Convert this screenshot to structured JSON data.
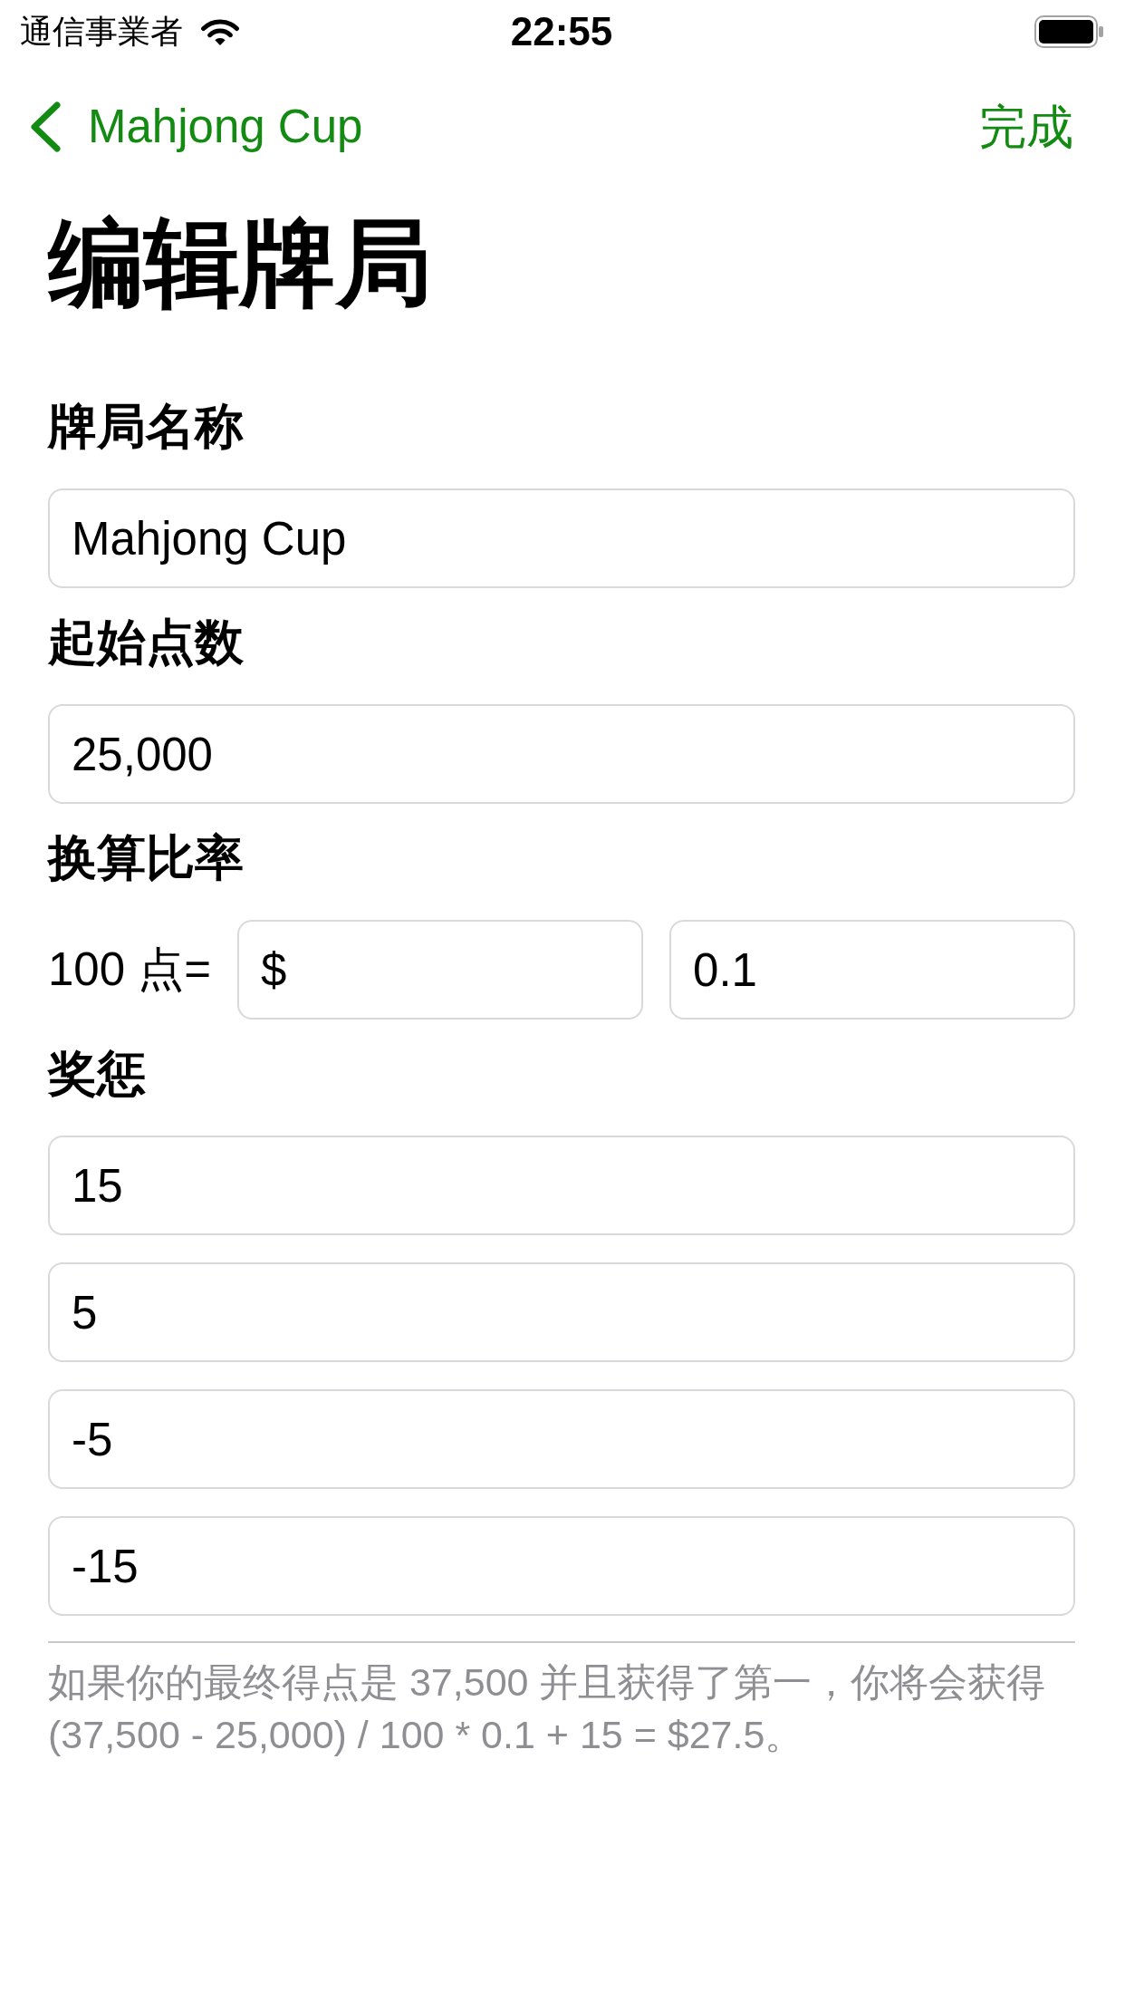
{
  "status_bar": {
    "carrier": "通信事業者",
    "time": "22:55"
  },
  "nav_bar": {
    "back_label": "Mahjong Cup",
    "done": "完成"
  },
  "title": "编辑牌局",
  "sections": [
    {
      "label": "牌局名称",
      "kind": "text",
      "fields": [
        {
          "value": "Mahjong Cup"
        }
      ]
    },
    {
      "label": "起始点数",
      "kind": "text",
      "fields": [
        {
          "value": "25,000"
        }
      ]
    },
    {
      "label": "换算比率",
      "kind": "rate",
      "prefix": "100 点=",
      "fields": [
        {
          "value": "$"
        },
        {
          "value": "0.1"
        }
      ]
    },
    {
      "label": "奖惩",
      "kind": "text",
      "fields": [
        {
          "value": "15"
        },
        {
          "value": "5"
        },
        {
          "value": "-5"
        },
        {
          "value": "-15"
        }
      ]
    }
  ],
  "footnote": "如果你的最终得点是 37,500 并且获得了第一，你将会获得 (37,500 - 25,000) / 100 * 0.1 + 15 = $27.5。"
}
